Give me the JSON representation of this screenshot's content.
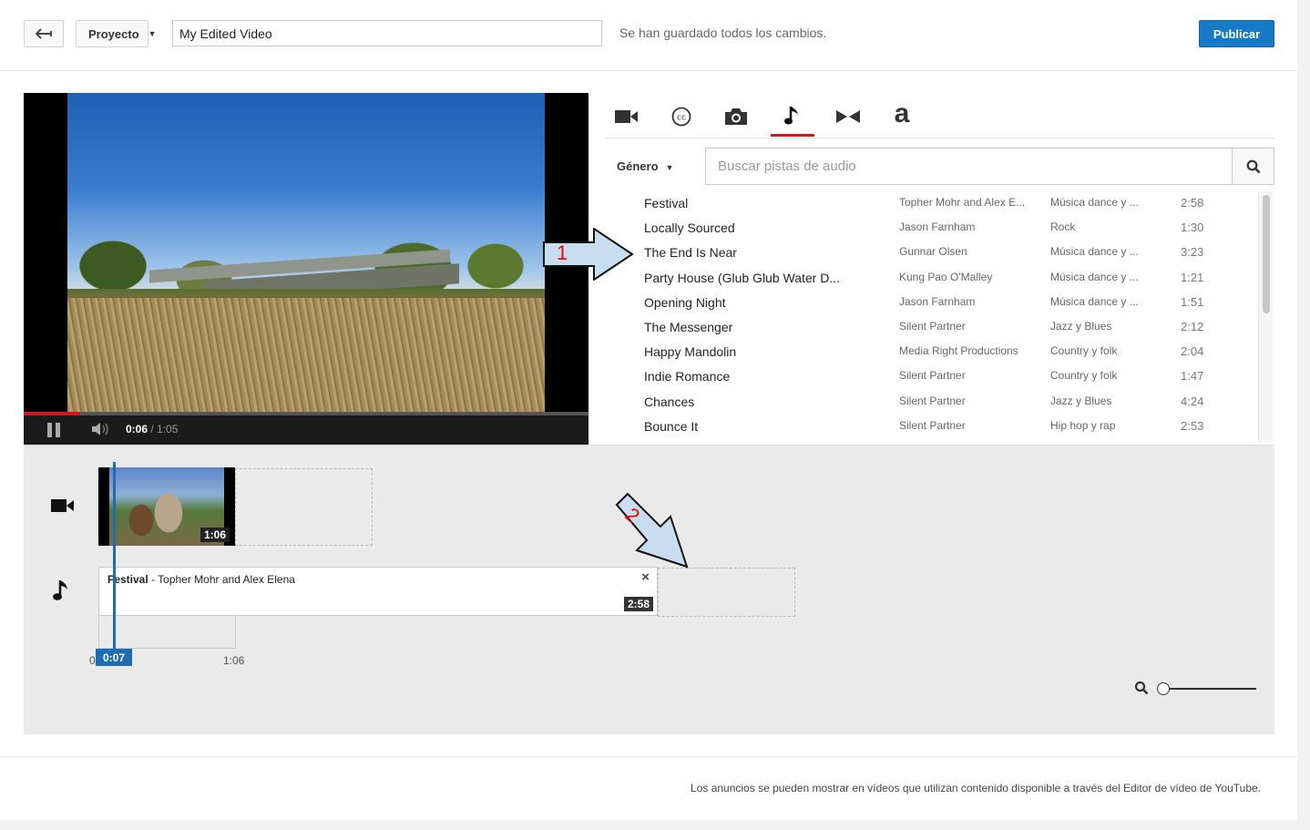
{
  "header": {
    "project_label": "Proyecto",
    "title_value": "My Edited Video",
    "saved_status": "Se han guardado todos los cambios.",
    "publish_label": "Publicar"
  },
  "player": {
    "current_time": "0:06",
    "duration": "/ 1:05",
    "progress": 0.1
  },
  "tabs": [
    {
      "name": "video-icon",
      "active": false
    },
    {
      "name": "captions-icon",
      "active": false
    },
    {
      "name": "photo-icon",
      "active": false
    },
    {
      "name": "music-icon",
      "active": true
    },
    {
      "name": "transitions-icon",
      "active": false
    },
    {
      "name": "text-icon",
      "active": false,
      "glyph": "a"
    }
  ],
  "audio_search": {
    "genre_label": "Género",
    "placeholder": "Buscar pistas de audio"
  },
  "tracks": [
    {
      "title": "Festival",
      "artist": "Topher Mohr and Alex E...",
      "genre": "Música dance y ...",
      "duration": "2:58"
    },
    {
      "title": "Locally Sourced",
      "artist": "Jason Farnham",
      "genre": "Rock",
      "duration": "1:30"
    },
    {
      "title": "The End Is Near",
      "artist": "Gunnar Olsen",
      "genre": "Música dance y ...",
      "duration": "3:23"
    },
    {
      "title": "Party House (Glub Glub Water D...",
      "artist": "Kung Pao O'Malley",
      "genre": "Música dance y ...",
      "duration": "1:21"
    },
    {
      "title": "Opening Night",
      "artist": "Jason Farnham",
      "genre": "Música dance y ...",
      "duration": "1:51"
    },
    {
      "title": "The Messenger",
      "artist": "Silent Partner",
      "genre": "Jazz y Blues",
      "duration": "2:12"
    },
    {
      "title": "Happy Mandolin",
      "artist": "Media Right Productions",
      "genre": "Country y folk",
      "duration": "2:04"
    },
    {
      "title": "Indie Romance",
      "artist": "Silent Partner",
      "genre": "Country y folk",
      "duration": "1:47"
    },
    {
      "title": "Chances",
      "artist": "Silent Partner",
      "genre": "Jazz y Blues",
      "duration": "4:24"
    },
    {
      "title": "Bounce It",
      "artist": "Silent Partner",
      "genre": "Hip hop y rap",
      "duration": "2:53"
    }
  ],
  "timeline": {
    "video_clip_duration": "1:06",
    "audio_clip_title": "Festival",
    "audio_clip_sep": " - ",
    "audio_clip_artist": "Topher Mohr and Alex Elena",
    "audio_clip_close": "×",
    "audio_clip_duration": "2:58",
    "ruler_start": "0",
    "ruler_end": "1:06",
    "playhead_time": "0:07"
  },
  "annotations": {
    "arrow_1_label": "1",
    "arrow_2_label": "2"
  },
  "footer": {
    "text": "Los anuncios se pueden mostrar en vídeos que utilizan contenido disponible a través del Editor de vídeo de YouTube."
  },
  "colors": {
    "accent_red": "#cc181e",
    "publish_blue": "#167ac6",
    "playhead_blue": "#1e6db4",
    "annotation_fill": "#c9ddf0"
  }
}
